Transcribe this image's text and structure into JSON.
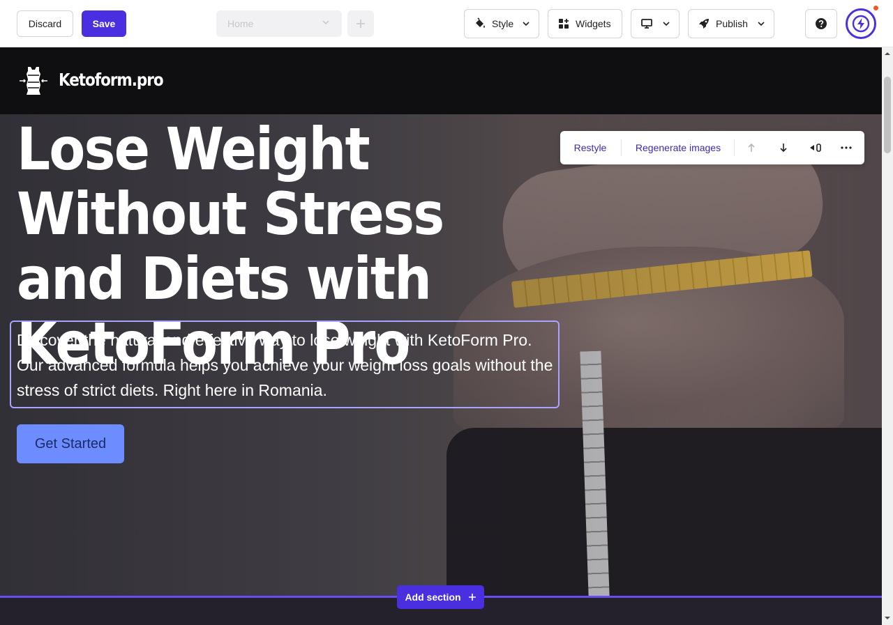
{
  "toolbar": {
    "discard_label": "Discard",
    "save_label": "Save",
    "page_select_value": "Home",
    "style_label": "Style",
    "widgets_label": "Widgets",
    "publish_label": "Publish"
  },
  "site": {
    "logo_text": "Ketoform.pro",
    "hero": {
      "title": "Lose Weight Without Stress and Diets with KetoForm Pro",
      "description": "Discover the natural and effective way to lose weight with KetoForm Pro. Our advanced formula helps you achieve your weight loss goals without the stress of strict diets. Right here in Romania.",
      "cta_label": "Get Started"
    }
  },
  "section_toolbar": {
    "restyle_label": "Restyle",
    "regenerate_label": "Regenerate images"
  },
  "add_section_label": "Add section",
  "colors": {
    "accent": "#4a2fe0",
    "cta": "#6d8cff",
    "notification": "#f05a28",
    "header_bg": "#0f0f12"
  },
  "icons": [
    "paint-bucket-icon",
    "widgets-icon",
    "desktop-icon",
    "rocket-icon",
    "help-icon",
    "lightning-icon",
    "chevron-down-icon",
    "plus-icon",
    "arrow-up-icon",
    "arrow-down-icon",
    "hide-icon",
    "more-icon",
    "logo-icon"
  ]
}
